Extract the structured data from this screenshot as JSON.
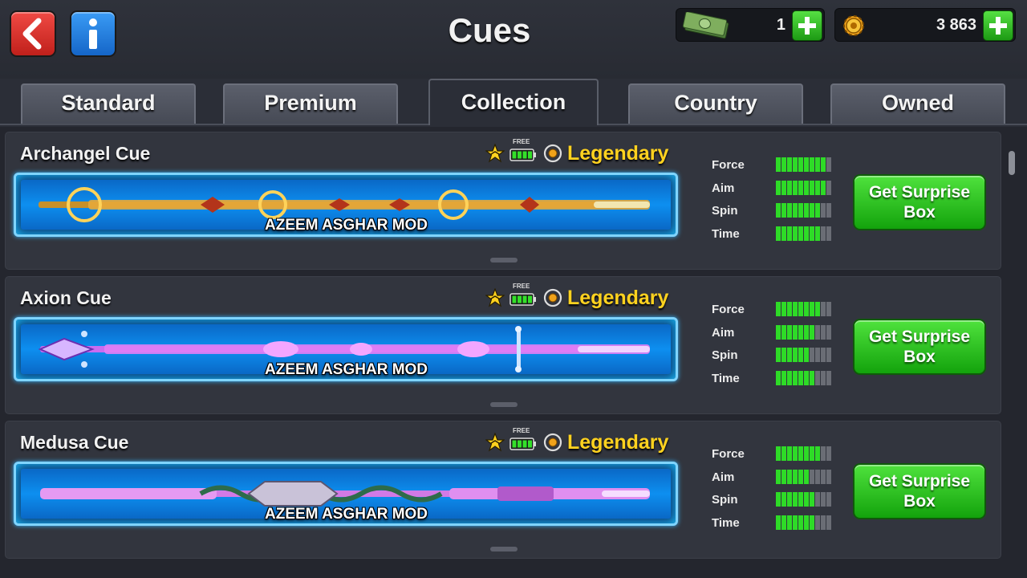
{
  "header": {
    "title": "Cues",
    "cash_value": "1",
    "coins_value": "3 863",
    "back_icon": "back-arrow-icon",
    "info_icon": "info-icon"
  },
  "tabs": [
    {
      "label": "Standard",
      "active": false
    },
    {
      "label": "Premium",
      "active": false
    },
    {
      "label": "Collection",
      "active": true
    },
    {
      "label": "Country",
      "active": false
    },
    {
      "label": "Owned",
      "active": false
    }
  ],
  "stat_labels": {
    "force": "Force",
    "aim": "Aim",
    "spin": "Spin",
    "time": "Time"
  },
  "cues": [
    {
      "name": "Archangel Cue",
      "rarity": "Legendary",
      "free_label": "FREE",
      "watermark": "AZEEM ASGHAR MOD",
      "button": "Get Surprise Box",
      "stats": {
        "force": 9,
        "aim": 9,
        "spin": 8,
        "time": 8
      },
      "theme": "gold"
    },
    {
      "name": "Axion Cue",
      "rarity": "Legendary",
      "free_label": "FREE",
      "watermark": "AZEEM ASGHAR MOD",
      "button": "Get Surprise Box",
      "stats": {
        "force": 8,
        "aim": 7,
        "spin": 6,
        "time": 7
      },
      "theme": "violet"
    },
    {
      "name": "Medusa Cue",
      "rarity": "Legendary",
      "free_label": "FREE",
      "watermark": "AZEEM ASGHAR MOD",
      "button": "Get Surprise Box",
      "stats": {
        "force": 8,
        "aim": 6,
        "spin": 7,
        "time": 7
      },
      "theme": "pink"
    }
  ],
  "stat_max": 10,
  "colors": {
    "legendary": "#ffd21f",
    "bar_on": "#2edb27",
    "button_green": "#2dc11f",
    "frame_blue": "#0d8ff0"
  }
}
